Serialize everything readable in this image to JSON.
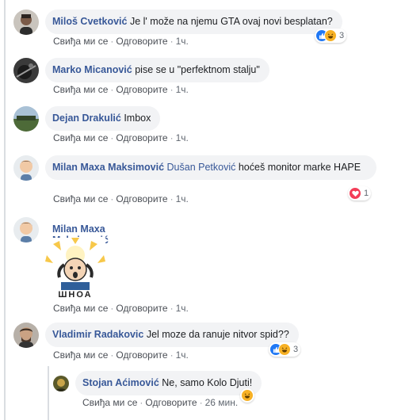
{
  "comments": [
    {
      "author": "Miloš Cvetković",
      "text": "Je l' može na njemu GTA ovaj novi besplatan?",
      "actions": {
        "like": "Свиђа ми се",
        "reply": "Одговорите",
        "time": "1ч."
      },
      "reactions": {
        "icons": [
          "like-icon",
          "haha-icon"
        ],
        "count": "3"
      }
    },
    {
      "author": "Marko Micanović",
      "text": "pise se u \"perfektnom stalju\"",
      "actions": {
        "like": "Свиђа ми се",
        "reply": "Одговорите",
        "time": "1ч."
      }
    },
    {
      "author": "Dejan Drakulić",
      "text": "Imbox",
      "actions": {
        "like": "Свиђа ми се",
        "reply": "Одговорите",
        "time": "1ч."
      }
    },
    {
      "author": "Milan Maxa Maksimović",
      "mention": "Dušan Petković",
      "text": "hoćeš monitor marke HAPE",
      "actions": {
        "like": "Свиђа ми се",
        "reply": "Одговорите",
        "time": "1ч."
      },
      "reactions": {
        "icons": [
          "love-icon"
        ],
        "count": "1"
      }
    },
    {
      "author": "Milan Maxa Maksimović",
      "gif_caption": "ШНОА",
      "actions": {
        "like": "Свиђа ми се",
        "reply": "Одговорите",
        "time": "1ч."
      }
    },
    {
      "author": "Vladimir Radakovic",
      "text": "Jel moze da ranuje nitvor spid??",
      "actions": {
        "like": "Свиђа ми се",
        "reply": "Одговорите",
        "time": "1ч."
      },
      "reactions": {
        "icons": [
          "like-icon",
          "haha-icon"
        ],
        "count": "3"
      }
    }
  ],
  "reply": {
    "author": "Stojan Aćimović",
    "text": "Ne, samo Kolo Djuti!",
    "actions": {
      "like": "Свиђа ми се",
      "reply": "Одговорите",
      "time": "26 мин."
    },
    "reactions": {
      "icons": [
        "haha-icon"
      ]
    }
  },
  "colors": {
    "author": "#385898",
    "bubble": "#f2f3f5",
    "like": "#2078f4",
    "love": "#f33e58",
    "haha": "#f7b125"
  }
}
